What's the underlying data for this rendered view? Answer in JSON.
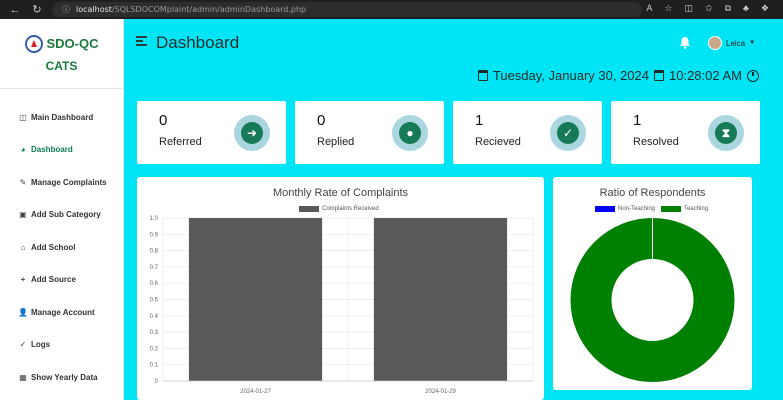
{
  "browser": {
    "url_host": "localhost",
    "url_path": "/SQLSDOCOMplaint/admin/adminDashboard.php"
  },
  "brand": {
    "name": "SDO-QC",
    "sub": "CATS"
  },
  "sidebar": {
    "items": [
      {
        "label": "Main Dashboard",
        "icon": "columns-icon",
        "glyph": "◫"
      },
      {
        "label": "Dashboard",
        "icon": "gauge-icon",
        "glyph": "◕"
      },
      {
        "label": "Manage Complaints",
        "icon": "wrench-icon",
        "glyph": "✎"
      },
      {
        "label": "Add Sub Category",
        "icon": "folder-plus-icon",
        "glyph": "▣"
      },
      {
        "label": "Add School",
        "icon": "school-icon",
        "glyph": "⌂"
      },
      {
        "label": "Add Source",
        "icon": "plus-icon",
        "glyph": "+"
      },
      {
        "label": "Manage Account",
        "icon": "user-plus-icon",
        "glyph": "👤"
      },
      {
        "label": "Logs",
        "icon": "check-icon",
        "glyph": "✓"
      },
      {
        "label": "Show Yearly Data",
        "icon": "calendar-icon",
        "glyph": "▦"
      }
    ],
    "active_index": 1
  },
  "header": {
    "title": "Dashboard",
    "user_name": "Leica",
    "date": "Tuesday, January 30, 2024",
    "time": "10:28:02 AM"
  },
  "stats": [
    {
      "value": "0",
      "label": "Referred",
      "icon": "arrow-right-icon",
      "glyph": "➜"
    },
    {
      "value": "0",
      "label": "Replied",
      "icon": "comment-icon",
      "glyph": "●"
    },
    {
      "value": "1",
      "label": "Recieved",
      "icon": "check-circle-icon",
      "glyph": "✓"
    },
    {
      "value": "1",
      "label": "Resolved",
      "icon": "hourglass-icon",
      "glyph": "⧗"
    }
  ],
  "colors": {
    "accent": "#00e5f5",
    "brand_green": "#1a7a3c",
    "icon_green": "#157a55",
    "bar": "#595959",
    "non_teaching": "#0000ff",
    "teaching": "#008000"
  },
  "chart_data": [
    {
      "type": "bar",
      "title": "Monthly Rate of Complaints",
      "categories": [
        "2024-01-27",
        "2024-01-29"
      ],
      "series": [
        {
          "name": "Complaints Received",
          "values": [
            1,
            1
          ]
        }
      ],
      "ylim": [
        0,
        1.0
      ],
      "yticks": [
        "0",
        "0.1",
        "0.2",
        "0.3",
        "0.4",
        "0.5",
        "0.6",
        "0.7",
        "0.8",
        "0.9",
        "1.0"
      ],
      "grid": true,
      "legend": "top"
    },
    {
      "type": "pie",
      "donut": true,
      "title": "Ratio of Respondents",
      "labels": [
        "Non-Teaching",
        "Teaching"
      ],
      "values": [
        0,
        1
      ],
      "legend": "top"
    }
  ]
}
